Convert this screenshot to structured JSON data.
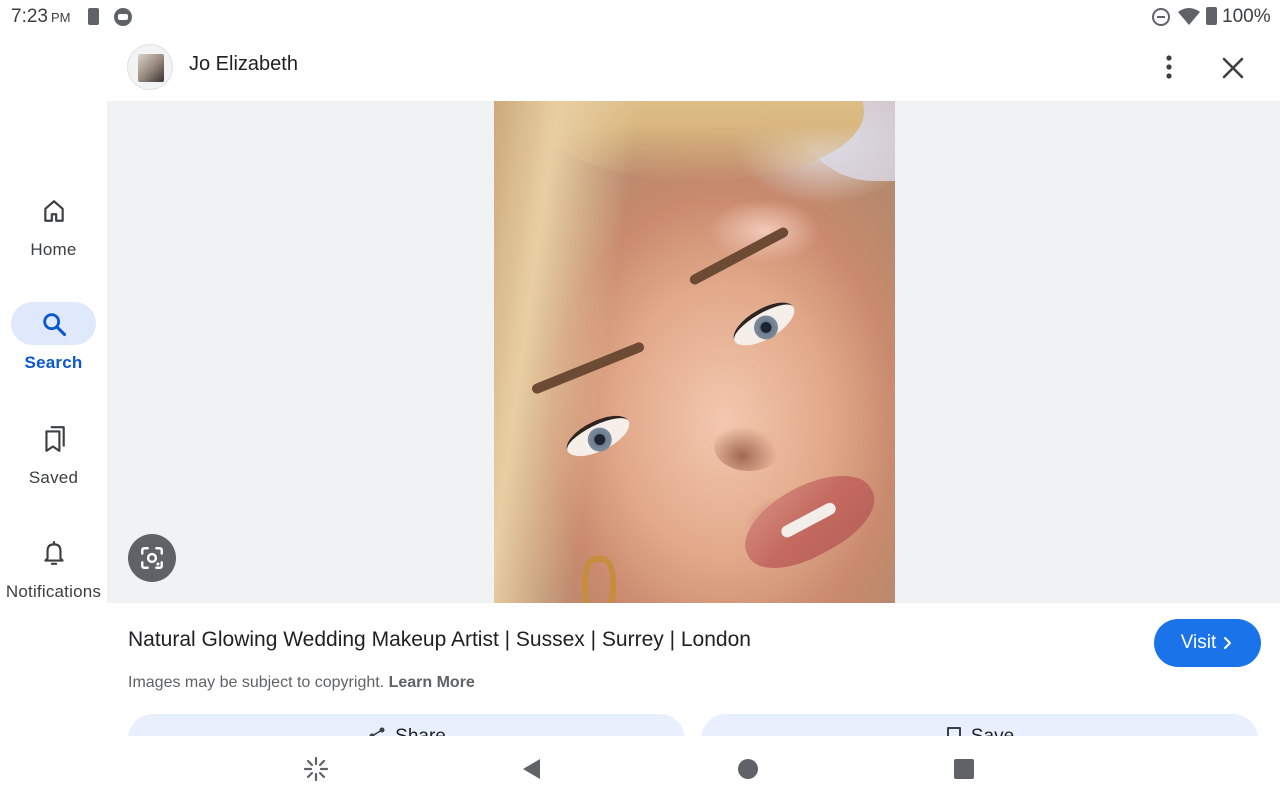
{
  "status_bar": {
    "time": "7:23",
    "ampm": "PM",
    "battery_percent": "100%"
  },
  "nav_rail": {
    "items": [
      {
        "label": "Home",
        "icon": "home-icon",
        "active": false
      },
      {
        "label": "Search",
        "icon": "search-icon",
        "active": true
      },
      {
        "label": "Saved",
        "icon": "bookmarks-icon",
        "active": false
      },
      {
        "label": "Notifications",
        "icon": "bell-icon",
        "active": false
      }
    ]
  },
  "header": {
    "author_name": "Jo Elizabeth"
  },
  "image": {
    "description_icon": "lens-icon"
  },
  "result": {
    "title": "Natural Glowing Wedding Makeup Artist | Sussex | Surrey | London",
    "visit_label": "Visit",
    "copyright_text": "Images may be subject to copyright.",
    "learn_more_label": "Learn More",
    "share_label": "Share",
    "save_label": "Save"
  },
  "colors": {
    "accent": "#1a73e8",
    "active_nav_pill": "#dfe9fb",
    "active_nav_text": "#0b57d0",
    "viewer_bg": "#f1f2f4",
    "action_bg": "#e8f0fe"
  }
}
